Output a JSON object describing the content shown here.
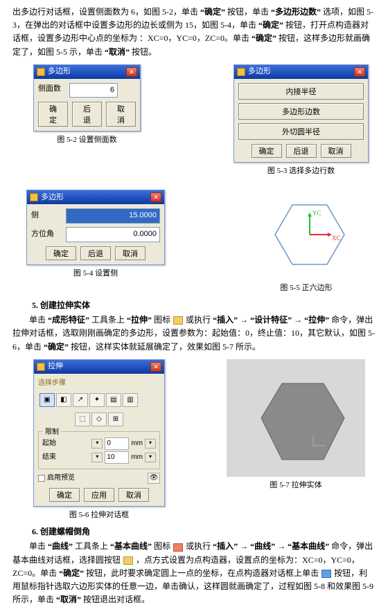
{
  "para1_a": "出多边行对话框，设置侧面数为 6，如图 5-2，单击",
  "btn_ok": "“确定”",
  "para1_b": "按钮，单击",
  "opt_sides": "“多边形边数”",
  "para1_c": "选项，如图 5-3，在弹出的对话框中设置多边形的边长或侧为 15，如图 5-4，单击",
  "para1_d": "按钮，打开点构造器对话框，设置多边形中心点的坐标为 ：XC=0，YC=0，ZC=0。单击",
  "para1_e": "按钮，这样多边形就画确定了，如图 5-5 示，单击",
  "btn_cancel": "“取消”",
  "para1_f": "按钮。",
  "dlg52": {
    "title": "多边形",
    "field1_label": "侧面数",
    "field1_value": "6",
    "ok": "确定",
    "back": "后退",
    "cancel": "取消"
  },
  "cap52": "图 5-2   设置侧面数",
  "dlg53": {
    "title": "多边形",
    "opt1": "内接半径",
    "opt2": "多边形边数",
    "opt3": "外切圆半径",
    "ok": "确定",
    "back": "后退",
    "cancel": "取消"
  },
  "cap53": "图 5-3   选择多边行数",
  "dlg54": {
    "title": "多边形",
    "field1_label": "侧",
    "field1_value": "15.0000",
    "field2_label": "方位角",
    "field2_value": "0.0000",
    "ok": "确定",
    "back": "后退",
    "cancel": "取消"
  },
  "cap54": "图 5-4   设置侧",
  "hex55": {
    "yc_label": "YC",
    "xc_label": "XC"
  },
  "cap55": "图 5-5   正六边形",
  "sec5": "5. 创建拉伸实体",
  "para5_a": "单击",
  "tool_shape": "“成形特征”",
  "para5_b": "工具条上",
  "tool_extrude": "“拉伸”",
  "para5_c": "图标",
  "para5_d": "或执行",
  "menu_insert": "“插入”",
  "arrow": " → ",
  "menu_designfeat": "“设计特征”",
  "para5_e": "命令，弹出拉伸对话框，选取刚刚画确定的多边形，设置参数为：起始值：0，终止值：10，其它默认，如图 5-6，单击",
  "para5_f": "按钮，这样实体就延展确定了，效果如图 5-7 所示。",
  "dlg56": {
    "title": "拉伸",
    "sel_label": "选择步骤",
    "group_limits": "限制",
    "start_lbl": "起始",
    "start_val": "0",
    "start_unit": "mm",
    "end_lbl": "结束",
    "end_val": "10",
    "end_unit": "mm",
    "checkbox_lbl": "启用预览",
    "ok": "确定",
    "apply": "应用",
    "cancel": "取消"
  },
  "cap56": "图 5-6   拉伸对话框",
  "cap57": "图 5-7   拉伸实体",
  "sec6": "6. 创建螺帽倒角",
  "tool_curve": "“曲线”",
  "tool_basic": "“基本曲线”",
  "para6_a": "单击",
  "para6_b": "工具条上",
  "para6_c": "图标",
  "para6_d": "或执行",
  "para6_e": "命令，弹出基本曲线对话框，选择圆按钮",
  "para6_f": "，点方式设置为点构造器，设置点的坐标为：XC=0，YC=0，ZC=0。单击",
  "para6_g": "按钮，此时要求确定圆上一点的坐标，在点构造器对话框上单击",
  "para6_h": "按钮，利用鼠标指针选取六边形实体的任意一边，单击确认，这样圆就画确定了，过程如图 5-8 和效果图 5-9 所示，单击",
  "para6_i": "按钮退出对话框。"
}
